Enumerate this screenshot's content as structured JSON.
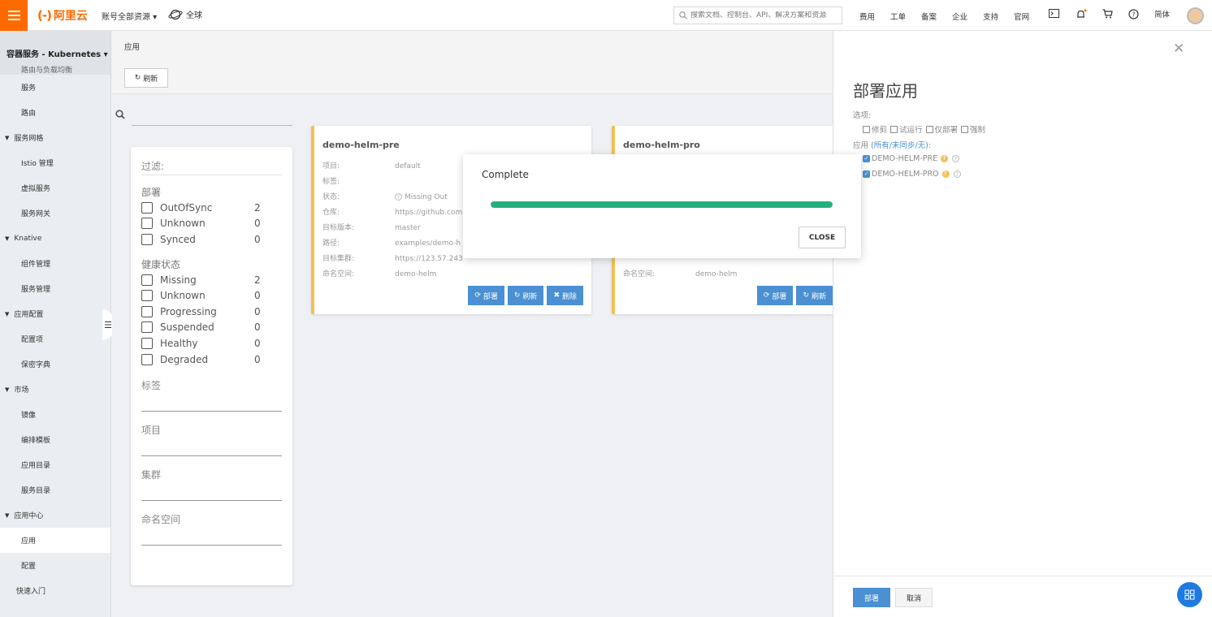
{
  "topbar": {
    "logo_text": "阿里云",
    "account": "账号全部资源 ▾",
    "region": "全球",
    "search_placeholder": "搜索文档、控制台、API、解决方案和资源",
    "nav": [
      "费用",
      "工单",
      "备案",
      "企业",
      "支持",
      "官网"
    ],
    "lang": "简体",
    "brand_color": "#ff6a00"
  },
  "sidebar": {
    "title": "容器服务 - Kubernetes ▾",
    "partial_item": "路由与负载均衡",
    "items": [
      {
        "label": "服务",
        "type": "sub"
      },
      {
        "label": "路由",
        "type": "sub"
      },
      {
        "label": "服务网格",
        "type": "section"
      },
      {
        "label": "Istio 管理",
        "type": "sub"
      },
      {
        "label": "虚拟服务",
        "type": "sub"
      },
      {
        "label": "服务网关",
        "type": "sub"
      },
      {
        "label": "Knative",
        "type": "section"
      },
      {
        "label": "组件管理",
        "type": "sub"
      },
      {
        "label": "服务管理",
        "type": "sub"
      },
      {
        "label": "应用配置",
        "type": "section"
      },
      {
        "label": "配置项",
        "type": "sub"
      },
      {
        "label": "保密字典",
        "type": "sub"
      },
      {
        "label": "市场",
        "type": "section"
      },
      {
        "label": "镜像",
        "type": "sub"
      },
      {
        "label": "编排模板",
        "type": "sub"
      },
      {
        "label": "应用目录",
        "type": "sub"
      },
      {
        "label": "服务目录",
        "type": "sub"
      },
      {
        "label": "应用中心",
        "type": "section"
      },
      {
        "label": "应用",
        "type": "sub",
        "active": true
      },
      {
        "label": "配置",
        "type": "sub"
      },
      {
        "label": "快速入门",
        "type": "plain"
      }
    ]
  },
  "content": {
    "breadcrumb": "应用",
    "refresh_label": "刷新",
    "filter": {
      "title": "过滤:",
      "deploy_title": "部署",
      "deploy_options": [
        {
          "label": "OutOfSync",
          "count": "2"
        },
        {
          "label": "Unknown",
          "count": "0"
        },
        {
          "label": "Synced",
          "count": "0"
        }
      ],
      "health_title": "健康状态",
      "health_options": [
        {
          "label": "Missing",
          "count": "2"
        },
        {
          "label": "Unknown",
          "count": "0"
        },
        {
          "label": "Progressing",
          "count": "0"
        },
        {
          "label": "Suspended",
          "count": "0"
        },
        {
          "label": "Healthy",
          "count": "0"
        },
        {
          "label": "Degraded",
          "count": "0"
        }
      ],
      "labels_title": "标签",
      "project_title": "项目",
      "cluster_title": "集群",
      "namespace_title": "命名空间"
    },
    "cards": [
      {
        "name": "demo-helm-pre",
        "rows": [
          {
            "key": "项目:",
            "value": "default"
          },
          {
            "key": "标签:",
            "value": ""
          },
          {
            "key": "状态:",
            "value": "Missing  Out"
          },
          {
            "key": "仓库:",
            "value": "https://github.com"
          },
          {
            "key": "目标版本:",
            "value": "master"
          },
          {
            "key": "路径:",
            "value": "examples/demo-h"
          },
          {
            "key": "目标集群:",
            "value": "https://123.57.243"
          },
          {
            "key": "命名空间:",
            "value": "demo-helm"
          }
        ],
        "buttons": [
          "部署",
          "刷新",
          "删除"
        ]
      },
      {
        "name": "demo-helm-pro",
        "rows": [
          {
            "key": "命名空间:",
            "value": "demo-helm"
          }
        ],
        "buttons": [
          "部署",
          "刷新"
        ]
      }
    ]
  },
  "modal": {
    "title": "Complete",
    "progress": 1.0,
    "progress_color": "#24b07a",
    "close_label": "CLOSE"
  },
  "panel": {
    "title": "部署应用",
    "options_label": "选项:",
    "options": [
      "修剪",
      "试运行",
      "仅部署",
      "强制"
    ],
    "apps_label": "应用",
    "apps_filter": "(所有/未同步/无):",
    "apps": [
      "DEMO-HELM-PRE",
      "DEMO-HELM-PRO"
    ],
    "deploy_label": "部署",
    "cancel_label": "取消"
  }
}
